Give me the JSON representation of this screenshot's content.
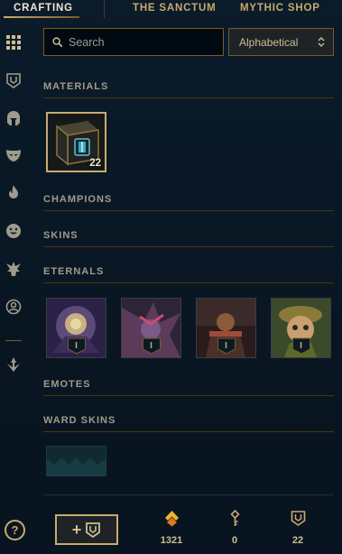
{
  "nav": {
    "tabs": [
      {
        "label": "CRAFTING",
        "active": true
      },
      {
        "label": "THE SANCTUM",
        "active": false
      },
      {
        "label": "MYTHIC SHOP",
        "active": false
      }
    ]
  },
  "sidebar": {
    "items": [
      {
        "icon": "grid-icon"
      },
      {
        "icon": "ward-shield-icon"
      },
      {
        "icon": "champion-helmet-icon"
      },
      {
        "icon": "skin-mask-icon"
      },
      {
        "icon": "eternals-flame-icon"
      },
      {
        "icon": "emote-face-icon"
      },
      {
        "icon": "ward-skin-icon"
      },
      {
        "icon": "summoner-icon"
      },
      {
        "icon": "other-loot-icon"
      }
    ],
    "help_label": "?"
  },
  "search": {
    "placeholder": "Search",
    "value": ""
  },
  "sort": {
    "selected": "Alphabetical"
  },
  "sections": {
    "materials": "MATERIALS",
    "champions": "CHAMPIONS",
    "skins": "SKINS",
    "eternals": "ETERNALS",
    "emotes": "EMOTES",
    "ward_skins": "WARD SKINS"
  },
  "materials": [
    {
      "name": "hextech chest",
      "count": "22"
    }
  ],
  "eternals": [
    {
      "tier": "I"
    },
    {
      "tier": "I"
    },
    {
      "tier": "I"
    },
    {
      "tier": "I"
    }
  ],
  "bottom": {
    "add_label": "+",
    "currencies": [
      {
        "icon": "orange-essence-icon",
        "value": "1321",
        "color": "#f0b232"
      },
      {
        "icon": "key-fragment-icon",
        "value": "0",
        "color": "#c8aa6e"
      },
      {
        "icon": "chest-count-icon",
        "value": "22",
        "color": "#c8aa6e"
      }
    ]
  },
  "colors": {
    "gold": "#c8aa6e",
    "gold_dark": "#785a28",
    "background": "#091622",
    "orange_essence": "#f0b232"
  }
}
